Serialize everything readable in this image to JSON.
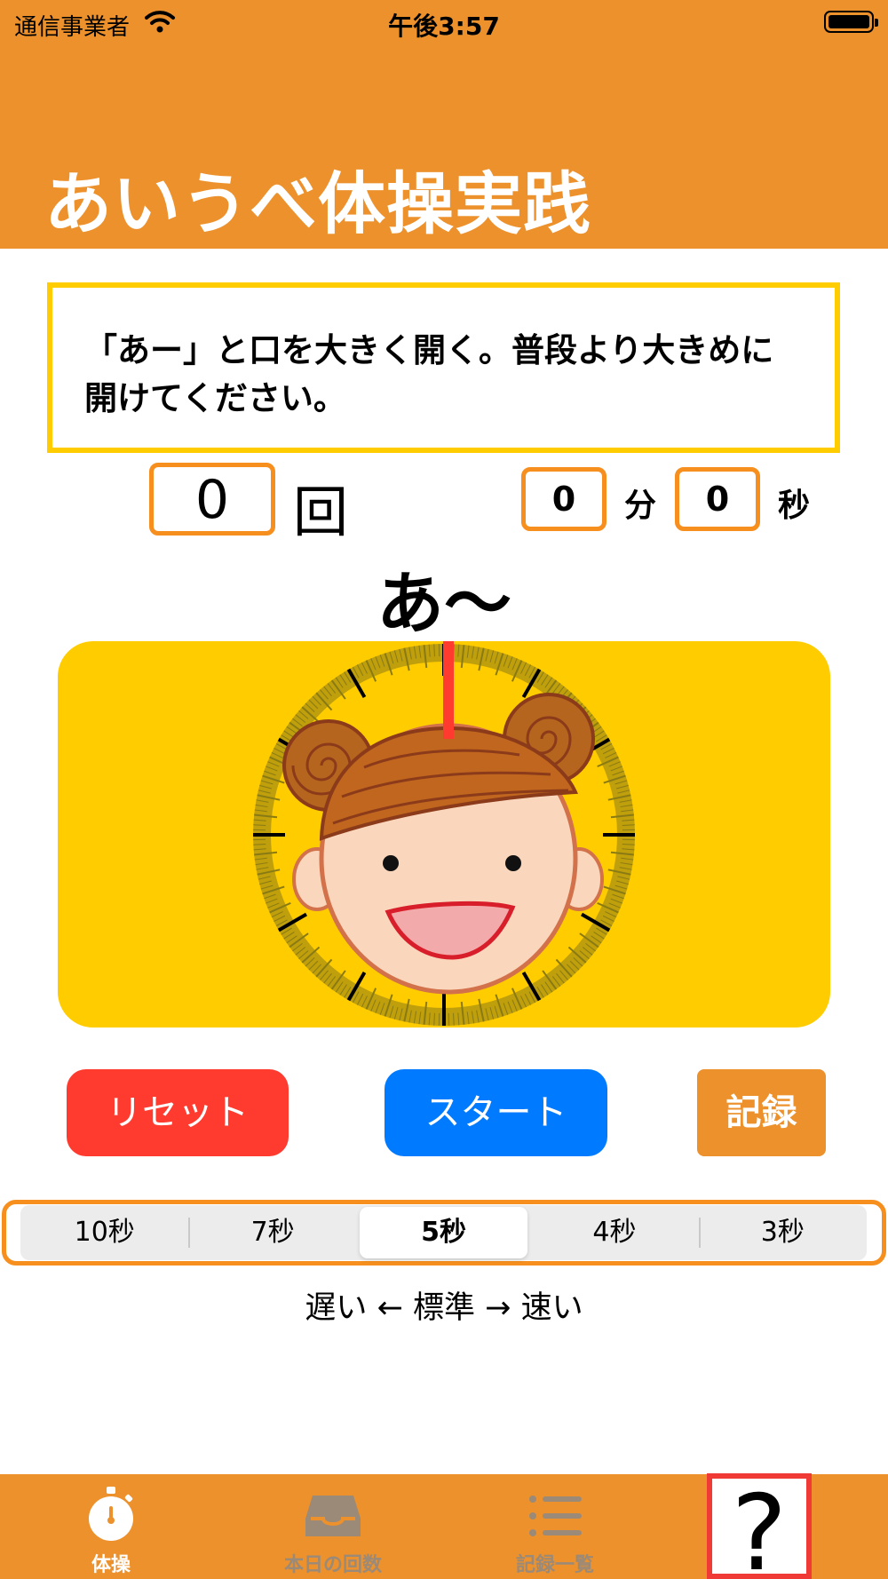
{
  "status_bar": {
    "carrier": "通信事業者",
    "time": "午後3:57"
  },
  "header": {
    "title": "あいうべ体操実践"
  },
  "instruction": {
    "text": "「あー」と口を大きく開く。普段より大きめに開けてください。"
  },
  "counter": {
    "count": "0",
    "unit": "回"
  },
  "timer": {
    "minutes": "0",
    "minutes_unit": "分",
    "seconds": "0",
    "seconds_unit": "秒"
  },
  "voice_text": "あ〜",
  "clock": {
    "needle_color": "#FF3B30",
    "dial_color": "#8A7A14",
    "needle_position_seconds": 0
  },
  "buttons": {
    "reset": "リセット",
    "start": "スタート",
    "record": "記録"
  },
  "speed": {
    "options": [
      "10秒",
      "7秒",
      "5秒",
      "4秒",
      "3秒"
    ],
    "selected": "5秒",
    "legend": "遅い ← 標準 → 速い"
  },
  "tabs": [
    {
      "label": "体操",
      "icon": "stopwatch-icon",
      "active": true
    },
    {
      "label": "本日の回数",
      "icon": "tray-icon",
      "active": false
    },
    {
      "label": "記録一覧",
      "icon": "list-icon",
      "active": false
    },
    {
      "label": "",
      "icon": "help-icon",
      "glyph": "?",
      "active": false
    }
  ],
  "colors": {
    "header": "#EC912C",
    "accent_border": "#F68F1E",
    "instruction_border": "#FFCC00",
    "reset": "#FF3B30",
    "start": "#007AFF",
    "highlight": "#EF3A36"
  }
}
